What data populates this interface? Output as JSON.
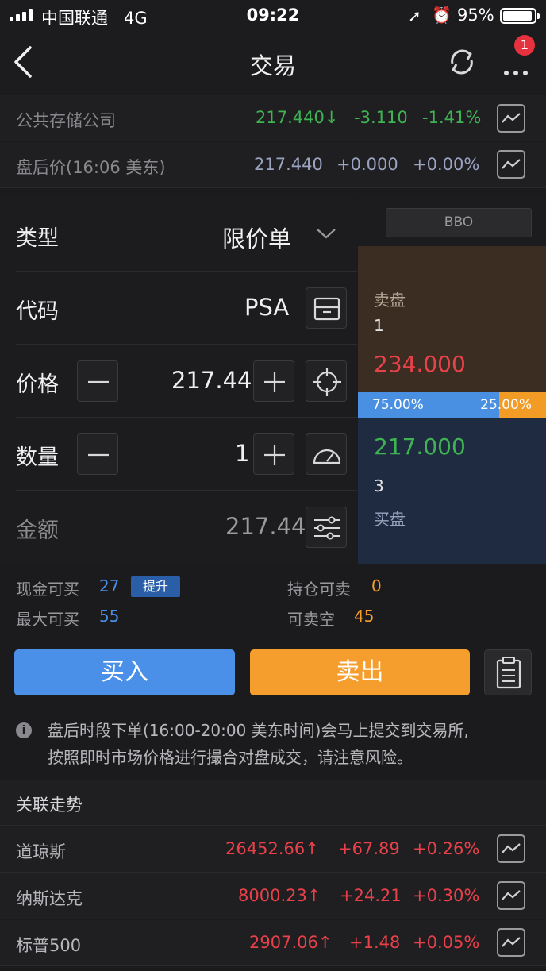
{
  "status_bar": {
    "carrier": "中国联通",
    "network": "4G",
    "time": "09:22",
    "battery": "95%"
  },
  "nav": {
    "title": "交易",
    "badge": "1",
    "icons": [
      "back-icon",
      "refresh-icon",
      "more-icon"
    ]
  },
  "quotes": {
    "main": {
      "name": "公共存储公司",
      "price": "217.440",
      "arrow": "↓",
      "change": "-3.110",
      "pct": "-1.41%"
    },
    "after_hours": {
      "name": "盘后价(16:06 美东)",
      "price": "217.440",
      "change": "+0.000",
      "pct": "+0.00%"
    }
  },
  "form": {
    "type_label": "类型",
    "type_value": "限价单",
    "code_label": "代码",
    "code_value": "PSA",
    "price_label": "价格",
    "price_value": "217.44",
    "qty_label": "数量",
    "qty_value": "1",
    "amount_label": "金额",
    "amount_value": "217.44"
  },
  "orderbook": {
    "bbo": "BBO",
    "ask_label": "卖盘",
    "ask_size": "1",
    "ask_price": "234.000",
    "buy_ratio": "75.00%",
    "sell_ratio": "25.00%",
    "buy_fraction": 0.75,
    "bid_price": "217.000",
    "bid_size": "3",
    "bid_label": "买盘"
  },
  "availability": {
    "cash_buy_label": "现金可买",
    "cash_buy_value": "27",
    "upgrade": "提升",
    "max_buy_label": "最大可买",
    "max_buy_value": "55",
    "position_sell_label": "持仓可卖",
    "position_sell_value": "0",
    "short_sell_label": "可卖空",
    "short_sell_value": "45"
  },
  "actions": {
    "buy": "买入",
    "sell": "卖出"
  },
  "notice": {
    "line1": "盘后时段下单(16:00-20:00 美东时间)会马上提交到交易所,",
    "line2": "按照即时市场价格进行撮合对盘成交，请注意风险。"
  },
  "related": {
    "title": "关联走势",
    "items": [
      {
        "name": "道琼斯",
        "price": "26452.66",
        "arrow": "↑",
        "change": "+67.89",
        "pct": "+0.26%"
      },
      {
        "name": "纳斯达克",
        "price": "8000.23",
        "arrow": "↑",
        "change": "+24.21",
        "pct": "+0.30%"
      },
      {
        "name": "标普500",
        "price": "2907.06",
        "arrow": "↑",
        "change": "+1.48",
        "pct": "+0.05%"
      }
    ]
  },
  "colors": {
    "up": "#e8414a",
    "down": "#3fb354",
    "buy": "#4a90e8",
    "sell": "#f59e2d"
  }
}
